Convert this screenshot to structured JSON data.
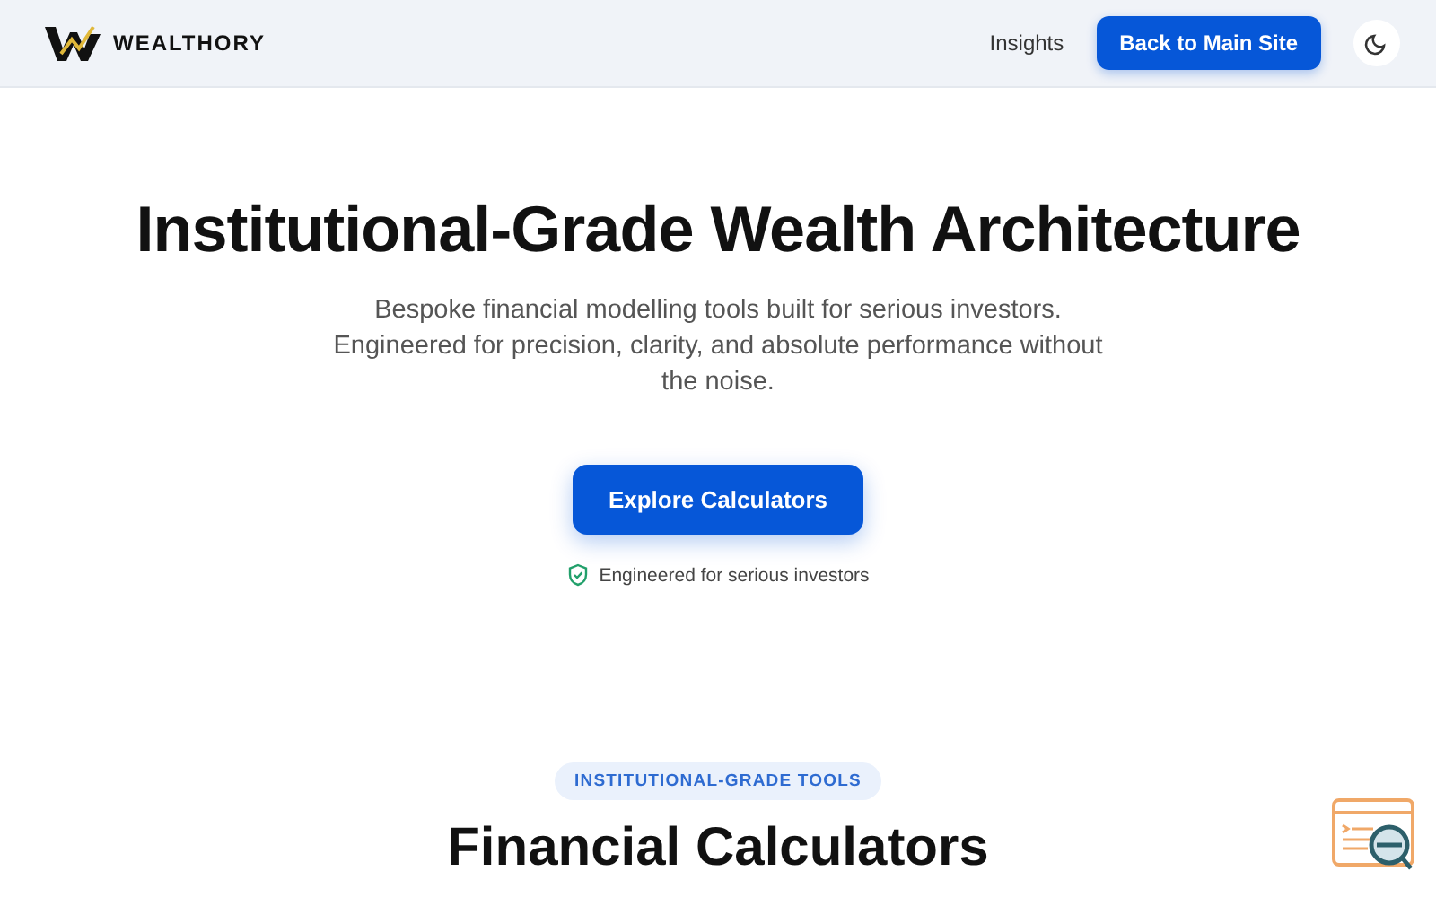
{
  "header": {
    "brand": "WEALTHORY",
    "nav": [
      {
        "label": "Insights"
      }
    ],
    "cta": "Back to Main Site"
  },
  "hero": {
    "title": "Institutional-Grade Wealth Architecture",
    "subtitle": "Bespoke financial modelling tools built for serious investors. Engineered for precision, clarity, and absolute performance without the noise.",
    "button": "Explore Calculators",
    "badge": "Engineered for serious investors"
  },
  "section": {
    "tag": "INSTITUTIONAL-GRADE TOOLS",
    "title": "Financial Calculators"
  }
}
